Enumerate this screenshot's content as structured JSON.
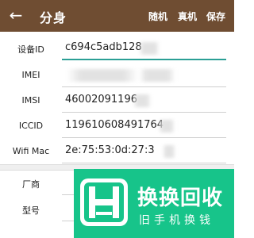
{
  "appbar": {
    "title": "分身",
    "actions": {
      "random": "随机",
      "real": "真机",
      "save": "保存"
    }
  },
  "fields": [
    {
      "label": "设备ID",
      "value": "c694c5adb128"
    },
    {
      "label": "IMEI",
      "value": ""
    },
    {
      "label": "IMSI",
      "value": "46002091196"
    },
    {
      "label": "ICCID",
      "value": "119610608491764"
    },
    {
      "label": "Wifi Mac",
      "value": "2e:75:53:0d:27:3"
    },
    {
      "label": "厂商",
      "value": ""
    },
    {
      "label": "型号",
      "value": ""
    }
  ],
  "watermark": {
    "big": "换换回收",
    "small": "旧手机换钱"
  },
  "colors": {
    "appbar": "#6f4d32",
    "accent": "#2b9f95",
    "watermark": "#17c48a"
  }
}
